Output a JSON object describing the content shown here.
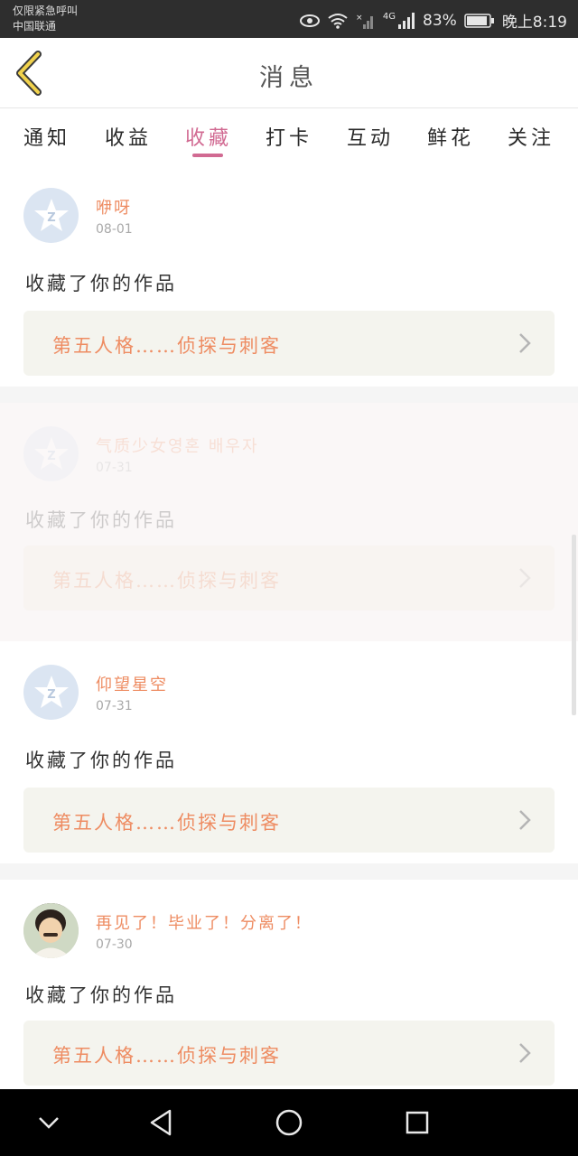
{
  "status_bar": {
    "line1": "仅限紧急呼叫",
    "line2": "中国联通",
    "network": "4G",
    "battery": "83%",
    "time": "晚上8:19",
    "icons": [
      "eye-icon",
      "wifi-icon",
      "signal-off-icon",
      "signal-icon",
      "battery-icon"
    ]
  },
  "header": {
    "title": "消息",
    "back_icon": "chevron-left-icon"
  },
  "tabs": [
    {
      "label": "通知",
      "active": false
    },
    {
      "label": "收益",
      "active": false
    },
    {
      "label": "收藏",
      "active": true
    },
    {
      "label": "打卡",
      "active": false
    },
    {
      "label": "互动",
      "active": false
    },
    {
      "label": "鲜花",
      "active": false
    },
    {
      "label": "关注",
      "active": false
    }
  ],
  "colors": {
    "accent": "#d16a92",
    "orange_text": "#ee8c62",
    "link_bg": "#f4f4ee"
  },
  "messages": [
    {
      "username": "咿呀",
      "date": "08-01",
      "action": "收藏了你的作品",
      "work_title": "第五人格……侦探与刺客",
      "avatar": "qq-default-avatar"
    },
    {
      "username": "气质少女영혼 배우자",
      "date": "07-31",
      "action": "收藏了你的作品",
      "work_title": "第五人格……侦探与刺客",
      "avatar": "qq-default-avatar"
    },
    {
      "username": "仰望星空",
      "date": "07-31",
      "action": "收藏了你的作品",
      "work_title": "第五人格……侦探与刺客",
      "avatar": "qq-default-avatar"
    },
    {
      "username": "再见了！毕业了！分离了！",
      "date": "07-30",
      "action": "收藏了你的作品",
      "work_title": "第五人格……侦探与刺客",
      "avatar": "photo-avatar"
    }
  ],
  "nav_bar": {
    "icons": [
      "chevron-down-icon",
      "back-triangle-icon",
      "home-circle-icon",
      "recents-square-icon"
    ]
  }
}
